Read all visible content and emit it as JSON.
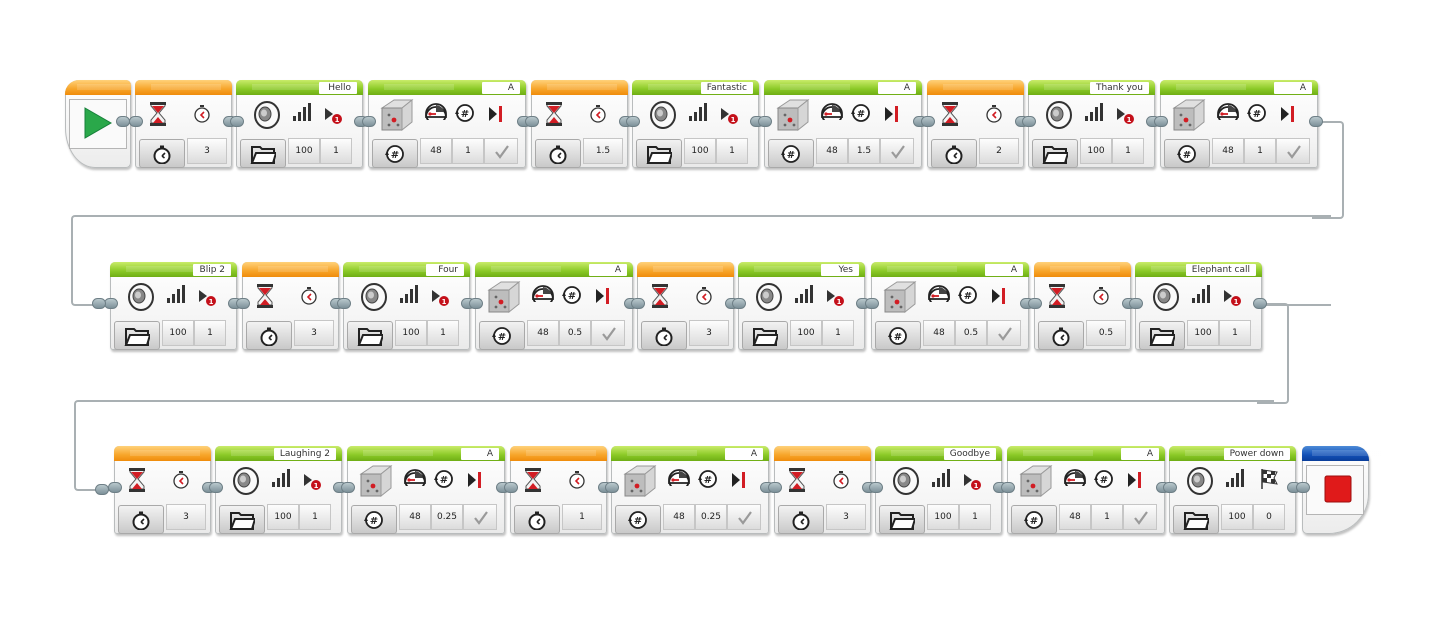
{
  "program": {
    "start": {
      "type": "start",
      "icon": "play-icon"
    },
    "rows": [
      [
        {
          "type": "wait",
          "mode_icon": "stopwatch-icon",
          "seconds": "3"
        },
        {
          "type": "sound",
          "file": "Hello",
          "volume": "100",
          "play_type": "1"
        },
        {
          "type": "motor",
          "port": "A",
          "power": "48",
          "rotations": "1",
          "brake": "✓"
        },
        {
          "type": "wait",
          "mode_icon": "stopwatch-icon",
          "seconds": "1.5"
        },
        {
          "type": "sound",
          "file": "Fantastic",
          "volume": "100",
          "play_type": "1"
        },
        {
          "type": "motor",
          "port": "A",
          "power": "48",
          "rotations": "1.5",
          "brake": "✓"
        },
        {
          "type": "wait",
          "mode_icon": "stopwatch-icon",
          "seconds": "2"
        },
        {
          "type": "sound",
          "file": "Thank you",
          "volume": "100",
          "play_type": "1"
        },
        {
          "type": "motor",
          "port": "A",
          "power": "48",
          "rotations": "1",
          "brake": "✓"
        }
      ],
      [
        {
          "type": "sound",
          "file": "Blip 2",
          "volume": "100",
          "play_type": "1"
        },
        {
          "type": "wait",
          "mode_icon": "stopwatch-icon",
          "seconds": "3"
        },
        {
          "type": "sound",
          "file": "Four",
          "volume": "100",
          "play_type": "1"
        },
        {
          "type": "motor",
          "port": "A",
          "power": "48",
          "rotations": "0.5",
          "brake": "✓"
        },
        {
          "type": "wait",
          "mode_icon": "stopwatch-icon",
          "seconds": "3"
        },
        {
          "type": "sound",
          "file": "Yes",
          "volume": "100",
          "play_type": "1"
        },
        {
          "type": "motor",
          "port": "A",
          "power": "48",
          "rotations": "0.5",
          "brake": "✓"
        },
        {
          "type": "wait",
          "mode_icon": "stopwatch-icon",
          "seconds": "0.5"
        },
        {
          "type": "sound",
          "file": "Elephant call",
          "volume": "100",
          "play_type": "1"
        }
      ],
      [
        {
          "type": "wait",
          "mode_icon": "stopwatch-icon",
          "seconds": "3"
        },
        {
          "type": "sound",
          "file": "Laughing 2",
          "volume": "100",
          "play_type": "1"
        },
        {
          "type": "motor",
          "port": "A",
          "power": "48",
          "rotations": "0.25",
          "brake": "✓"
        },
        {
          "type": "wait",
          "mode_icon": "stopwatch-icon",
          "seconds": "1"
        },
        {
          "type": "motor",
          "port": "A",
          "power": "48",
          "rotations": "0.25",
          "brake": "✓"
        },
        {
          "type": "wait",
          "mode_icon": "stopwatch-icon",
          "seconds": "3"
        },
        {
          "type": "sound",
          "file": "Goodbye",
          "volume": "100",
          "play_type": "1"
        },
        {
          "type": "motor",
          "port": "A",
          "power": "48",
          "rotations": "1",
          "brake": "✓"
        },
        {
          "type": "sound",
          "file": "Power down",
          "volume": "100",
          "play_type": "0",
          "finish_icon": "checkered-flag-icon"
        }
      ]
    ],
    "end": {
      "type": "stop",
      "icon": "stop-icon"
    }
  },
  "colors": {
    "action_green": "#8ac926",
    "flow_orange": "#f7a52a",
    "stop_blue": "#1250b6",
    "accent_red": "#d0121b",
    "start_green": "#2aa84a",
    "wire_gray": "#a9b0b3"
  }
}
